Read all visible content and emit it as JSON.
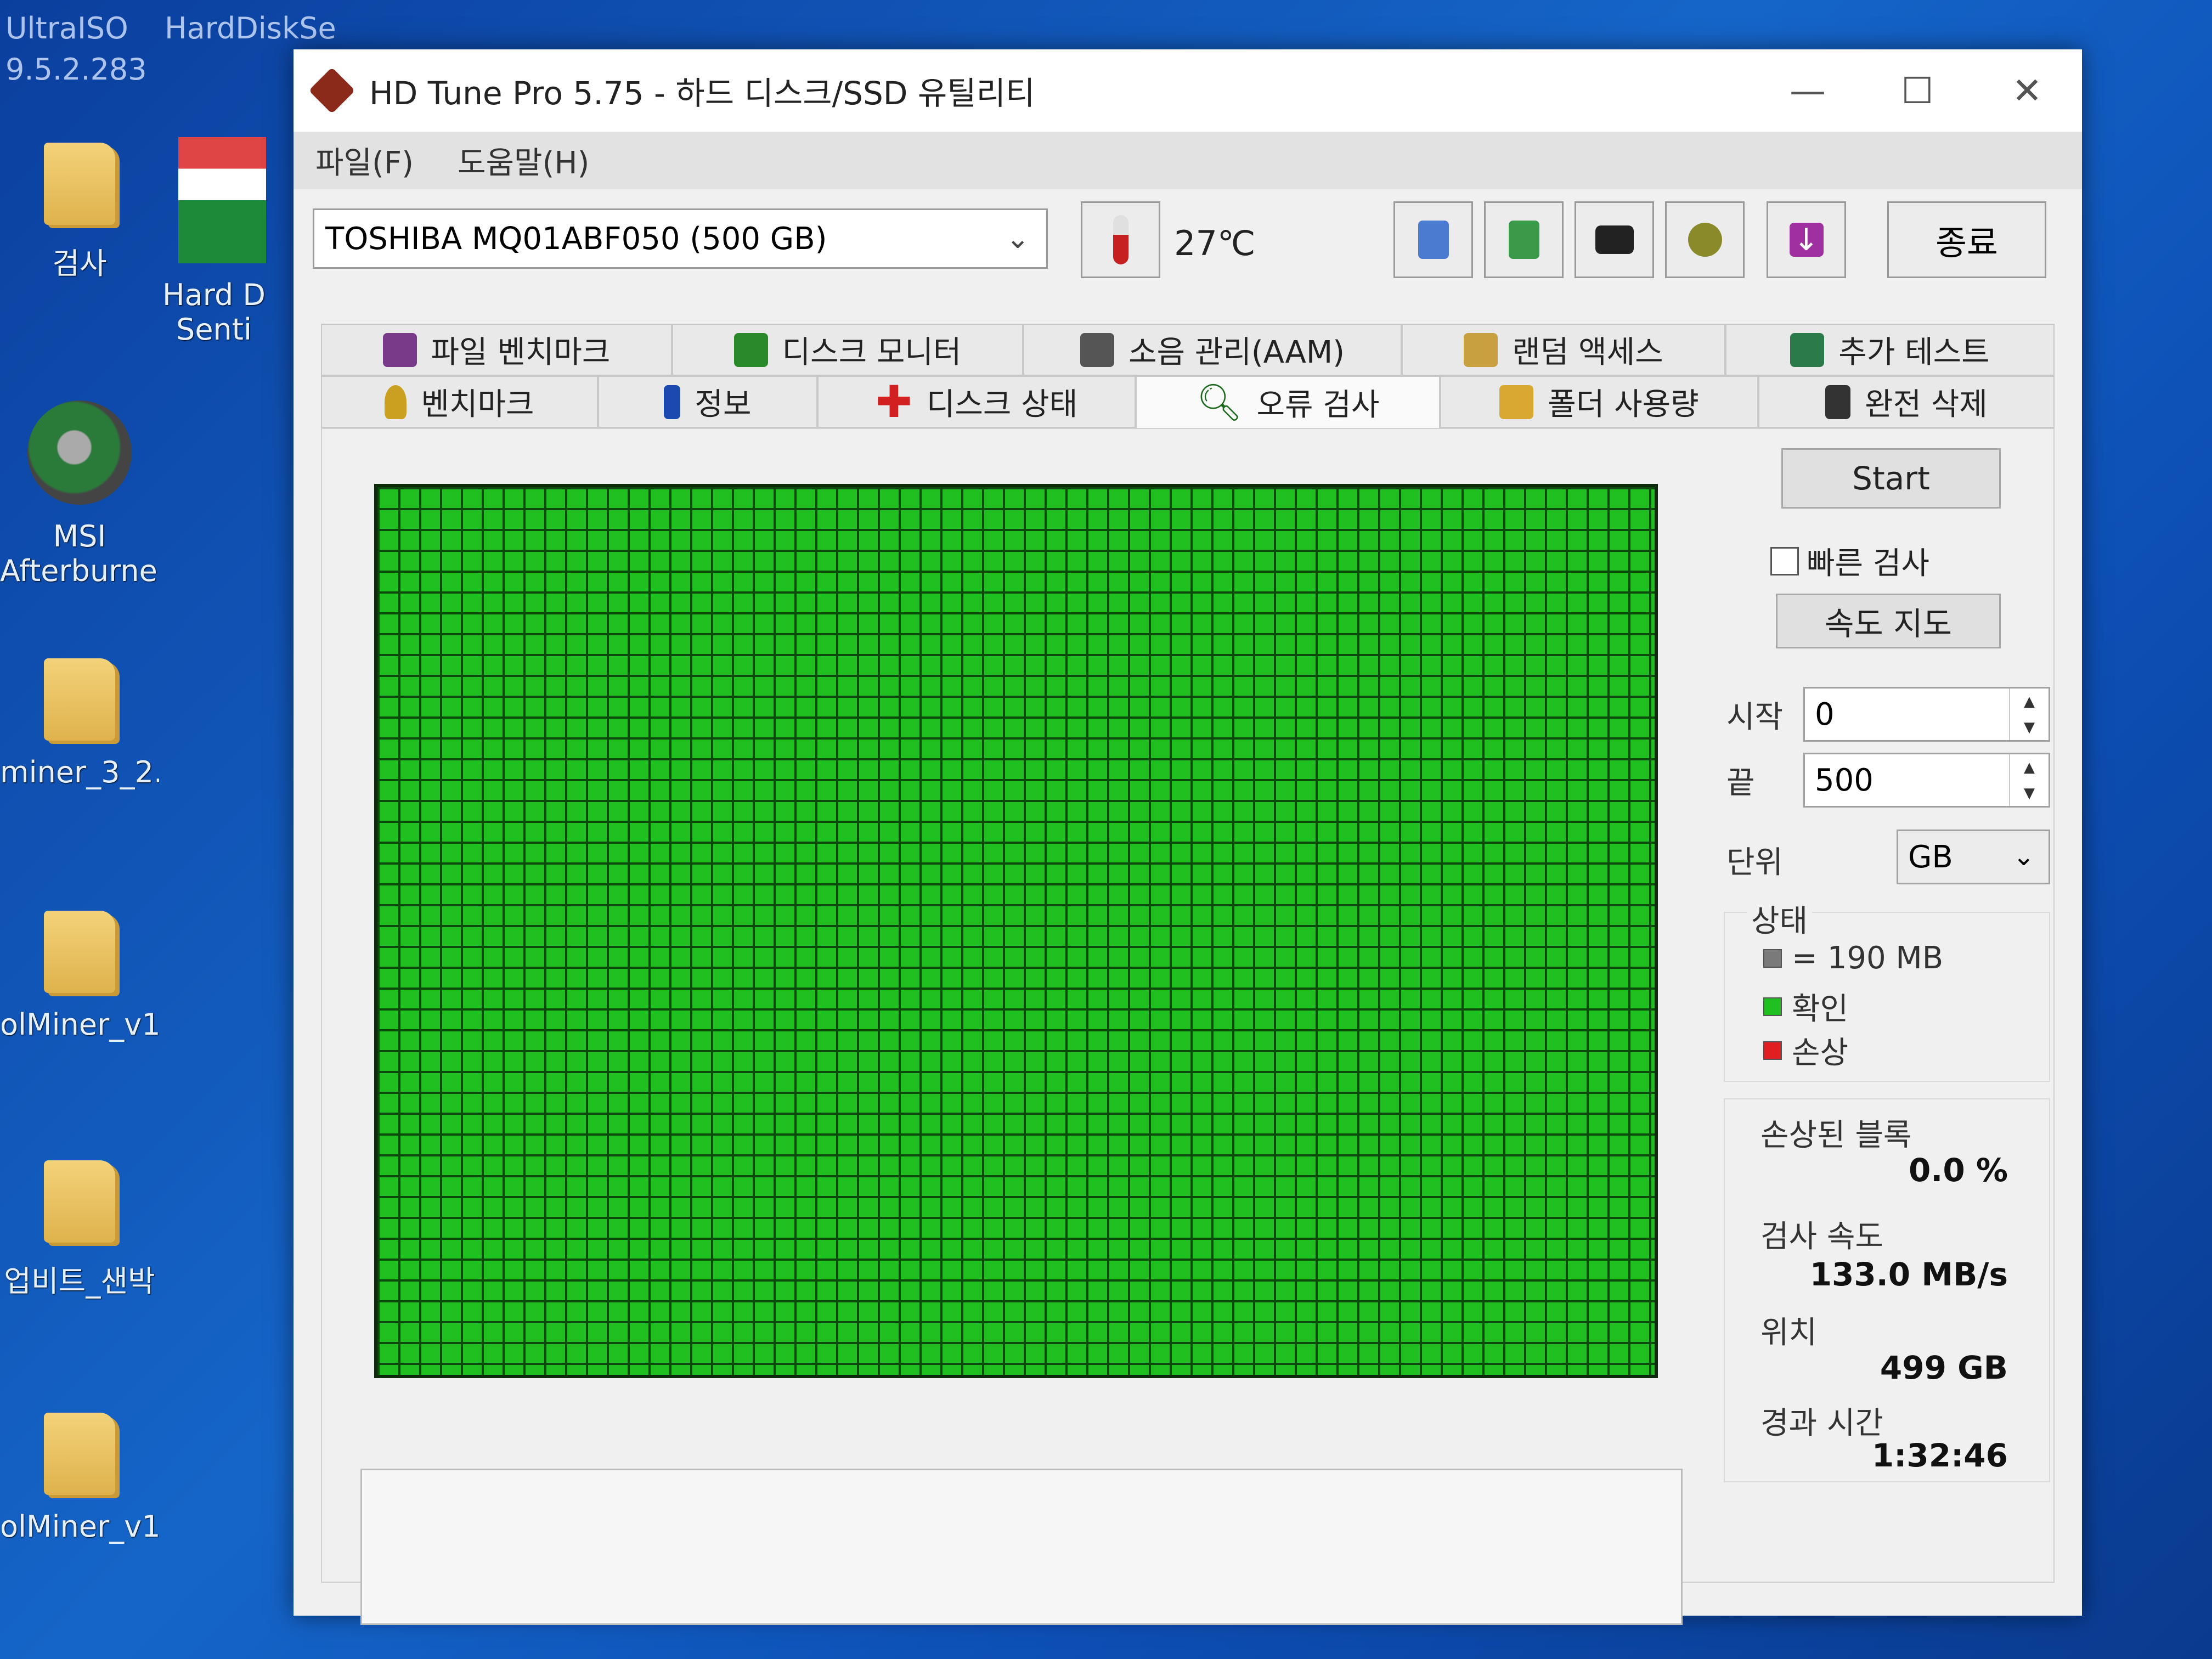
{
  "desktop": {
    "top_labels": [
      "UltraISO",
      "9.5.2.283",
      "HardDiskSe"
    ],
    "icons": [
      {
        "label": "검사"
      },
      {
        "label": "Hard D Senti"
      },
      {
        "label": "MSI Afterburner"
      },
      {
        "label": "miner_3_2..."
      },
      {
        "label": "olMiner_v1..."
      },
      {
        "label": "업비트_샌박"
      },
      {
        "label": "olMiner_v1..."
      }
    ]
  },
  "window": {
    "title": "HD Tune Pro 5.75 - 하드 디스크/SSD 유틸리티",
    "controls": {
      "minimize": "—",
      "maximize": "☐",
      "close": "✕"
    }
  },
  "menu": {
    "file": "파일(F)",
    "help": "도움말(H)"
  },
  "toolbar": {
    "drive": "TOSHIBA MQ01ABF050 (500 GB)",
    "temperature": "27℃",
    "exit": "종료",
    "icons": [
      "copy-info-icon",
      "copy-screen-icon",
      "camera-icon",
      "settings-icon",
      "download-icon"
    ]
  },
  "tabs": {
    "row1": [
      "파일 벤치마크",
      "디스크 모니터",
      "소음 관리(AAM)",
      "랜덤 액세스",
      "추가 테스트"
    ],
    "row2": [
      "벤치마크",
      "정보",
      "디스크 상태",
      "오류 검사",
      "폴더 사용량",
      "완전 삭제"
    ],
    "active": "오류 검사"
  },
  "scan": {
    "start": "Start",
    "quick_scan": "빠른 검사",
    "quick_scan_checked": false,
    "speed_map": "속도 지도",
    "start_label": "시작",
    "start_value": "0",
    "end_label": "끝",
    "end_value": "500",
    "unit_label": "단위",
    "unit_value": "GB",
    "status_label": "상태",
    "legend": {
      "block": "= 190 MB",
      "ok": "확인",
      "damaged": "손상"
    },
    "damaged_blocks_label": "손상된 블록",
    "damaged_blocks_value": "0.0 %",
    "speed_label": "검사 속도",
    "speed_value": "133.0 MB/s",
    "position_label": "위치",
    "position_value": "499 GB",
    "elapsed_label": "경과 시간",
    "elapsed_value": "1:32:46"
  },
  "colors": {
    "ok_block": "#20c020",
    "grid_line": "#0c4a0c",
    "damaged": "#e02020",
    "block_gray": "#7a7a7a"
  }
}
